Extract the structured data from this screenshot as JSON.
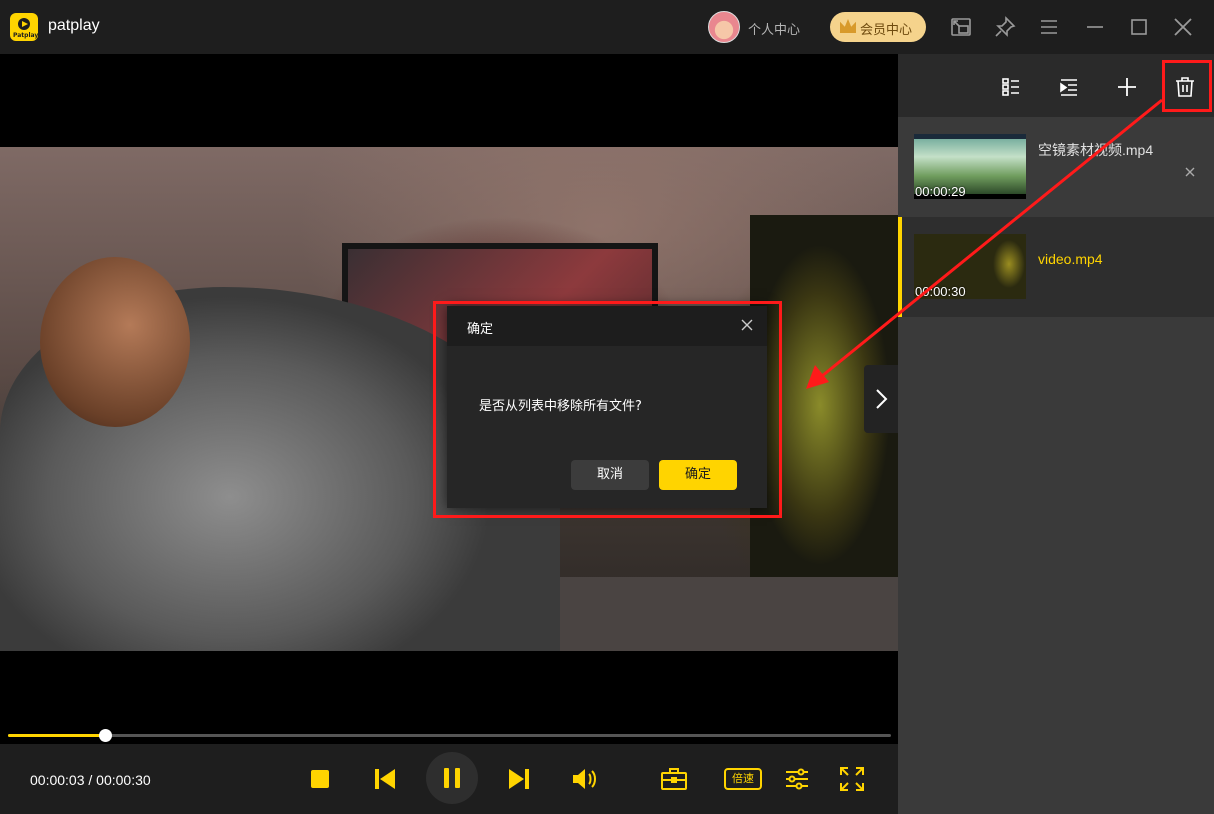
{
  "app": {
    "name": "patplay",
    "logo_text": "Patplay"
  },
  "header": {
    "personal_center": "个人中心",
    "vip_center": "会员中心",
    "icons": [
      "picture-in-picture-icon",
      "pin-icon",
      "menu-icon",
      "minimize-icon",
      "maximize-icon",
      "close-icon"
    ]
  },
  "player": {
    "current_time": "00:00:03",
    "total_time": "00:00:30",
    "time_display": "00:00:03 / 00:00:30",
    "progress_fraction": 0.11,
    "speed_label": "倍速",
    "accent_color": "#ffd400"
  },
  "playlist": {
    "toolbar_icons": [
      "list-view-icon",
      "playlist-mode-icon",
      "add-icon",
      "trash-icon"
    ],
    "items": [
      {
        "title": "空镜素材视频.mp4",
        "duration": "00:00:29",
        "active": false
      },
      {
        "title": "video.mp4",
        "duration": "00:00:30",
        "active": true
      }
    ]
  },
  "dialog": {
    "title": "确定",
    "message": "是否从列表中移除所有文件?",
    "cancel_label": "取消",
    "confirm_label": "确定"
  },
  "annotation_color": "#ff1a1a"
}
